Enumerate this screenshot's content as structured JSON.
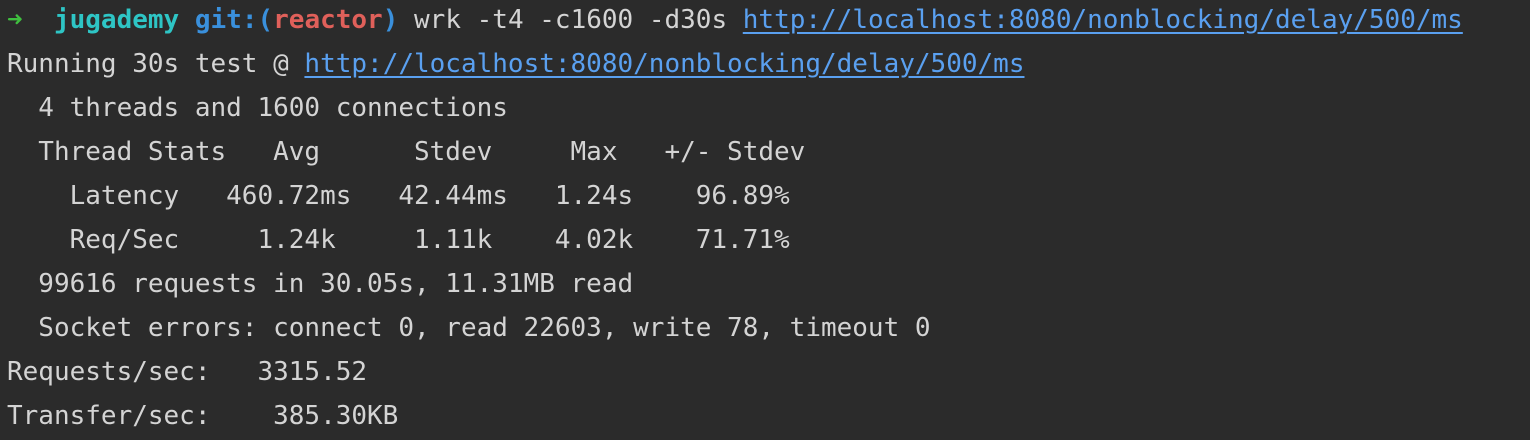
{
  "prompt": {
    "arrow": "➜",
    "user": "jugademy",
    "git_prefix": "git:(",
    "branch": "reactor",
    "git_suffix": ")",
    "command": "wrk -t4 -c1600 -d30s",
    "url": "http://localhost:8080/nonblocking/delay/500/ms"
  },
  "output": {
    "running_prefix": "Running 30s test @ ",
    "running_url": "http://localhost:8080/nonblocking/delay/500/ms",
    "threads_line": "  4 threads and 1600 connections",
    "stats_header": "  Thread Stats   Avg      Stdev     Max   +/- Stdev",
    "latency_row": "    Latency   460.72ms   42.44ms   1.24s    96.89%",
    "reqsec_row": "    Req/Sec     1.24k     1.11k    4.02k    71.71%",
    "requests_line": "  99616 requests in 30.05s, 11.31MB read",
    "socket_errors_line": "  Socket errors: connect 0, read 22603, write 78, timeout 0",
    "requests_per_sec_line": "Requests/sec:   3315.52",
    "transfer_per_sec_line": "Transfer/sec:    385.30KB"
  }
}
